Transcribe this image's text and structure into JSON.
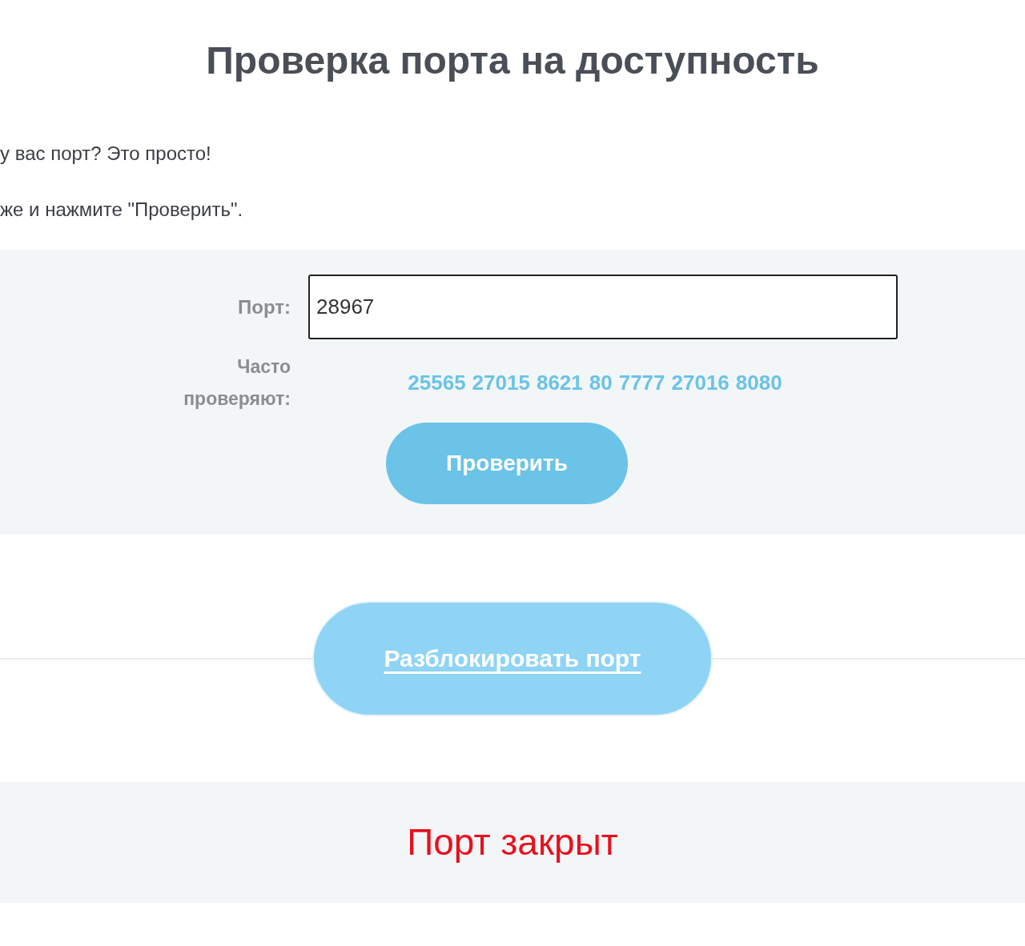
{
  "title": "Проверка порта на доступность",
  "intro": [
    "у вас порт? Это просто!",
    "же и нажмите \"Проверить\"."
  ],
  "form": {
    "port_label": "Порт:",
    "port_value": "28967",
    "popular_label": "Часто проверяют:",
    "popular_ports": [
      "25565",
      "27015",
      "8621",
      "80",
      "7777",
      "27016",
      "8080"
    ],
    "check_button": "Проверить"
  },
  "unblock_button": "Разблокировать порт",
  "result": {
    "open": false,
    "text": "Порт закрыт"
  }
}
